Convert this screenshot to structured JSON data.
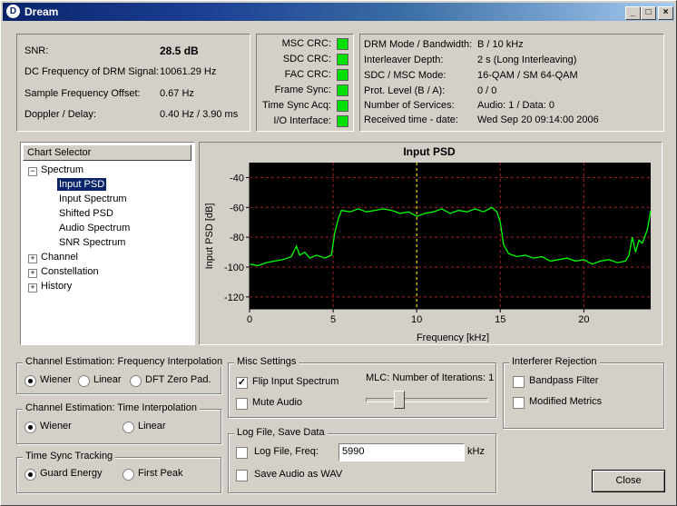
{
  "window": {
    "title": "Dream",
    "min_glyph": "_",
    "max_glyph": "□",
    "close_glyph": "×"
  },
  "status": {
    "snr_label": "SNR:",
    "snr_value": "28.5 dB",
    "dc_freq_label": "DC Frequency of DRM Signal:",
    "dc_freq_value": "10061.29 Hz",
    "sample_offset_label": "Sample Frequency Offset:",
    "sample_offset_value": "0.67 Hz",
    "doppler_label": "Doppler / Delay:",
    "doppler_value": "0.40 Hz / 3.90 ms"
  },
  "crc": {
    "msc": "MSC CRC:",
    "sdc": "SDC CRC:",
    "fac": "FAC CRC:",
    "frame_sync": "Frame Sync:",
    "time_sync": "Time Sync Acq:",
    "io": "I/O Interface:",
    "led_color": "#00e000"
  },
  "drm_info": {
    "mode_label": "DRM Mode / Bandwidth:",
    "mode_value": "B / 10 kHz",
    "interleaver_label": "Interleaver Depth:",
    "interleaver_value": "2 s (Long Interleaving)",
    "sdc_msc_label": "SDC / MSC Mode:",
    "sdc_msc_value": "16-QAM / SM 64-QAM",
    "prot_label": "Prot. Level (B / A):",
    "prot_value": "0 / 0",
    "services_label": "Number of Services:",
    "services_value": "Audio: 1 / Data: 0",
    "received_label": "Received time - date:",
    "received_value": "Wed Sep 20 09:14:00 2006"
  },
  "chart_selector": {
    "header": "Chart Selector",
    "spectrum": "Spectrum",
    "children": [
      "Input PSD",
      "Input Spectrum",
      "Shifted PSD",
      "Audio Spectrum",
      "SNR Spectrum"
    ],
    "channel": "Channel",
    "constellation": "Constellation",
    "history": "History",
    "expand_glyph": "+",
    "collapse_glyph": "−"
  },
  "chart_data": {
    "type": "line",
    "title": "Input PSD",
    "xlabel": "Frequency [kHz]",
    "ylabel": "Input PSD [dB]",
    "xlim": [
      0,
      24
    ],
    "ylim": [
      -128,
      -30
    ],
    "xticks": [
      "0",
      "5",
      "10",
      "15",
      "20"
    ],
    "yticks": [
      "-40",
      "-60",
      "-80",
      "-100",
      "-120"
    ],
    "marker_x": 10,
    "colors": {
      "background": "#000000",
      "grid": "#a02020",
      "line": "#00ff00",
      "marker": "#ffff00"
    },
    "x": [
      0,
      0.5,
      1,
      1.5,
      2,
      2.5,
      2.8,
      3,
      3.3,
      3.6,
      4,
      4.5,
      4.9,
      5.1,
      5.3,
      5.5,
      6,
      6.5,
      7,
      7.5,
      8,
      8.5,
      9,
      9.5,
      10,
      10.5,
      11,
      11.5,
      12,
      12.5,
      13,
      13.5,
      14,
      14.5,
      14.8,
      15,
      15.2,
      15.5,
      16,
      16.5,
      17,
      17.5,
      18,
      18.5,
      19,
      19.5,
      20,
      20.5,
      21,
      21.5,
      22,
      22.5,
      22.7,
      22.9,
      23.1,
      23.3,
      23.5,
      23.8,
      24
    ],
    "y": [
      -98,
      -99,
      -97,
      -96,
      -95,
      -93,
      -86,
      -92,
      -90,
      -94,
      -92,
      -94,
      -92,
      -77,
      -68,
      -62,
      -63,
      -61,
      -63,
      -62,
      -61,
      -62,
      -64,
      -63,
      -66,
      -64,
      -63,
      -61,
      -64,
      -62,
      -63,
      -61,
      -63,
      -60,
      -63,
      -70,
      -85,
      -91,
      -93,
      -92,
      -94,
      -93,
      -96,
      -95,
      -94,
      -96,
      -95,
      -98,
      -96,
      -95,
      -97,
      -96,
      -92,
      -80,
      -90,
      -82,
      -84,
      -75,
      -62
    ]
  },
  "freq_interp": {
    "title": "Channel Estimation: Frequency Interpolation",
    "options": [
      "Wiener",
      "Linear",
      "DFT Zero Pad."
    ],
    "selected": "Wiener"
  },
  "time_interp": {
    "title": "Channel Estimation: Time Interpolation",
    "options": [
      "Wiener",
      "Linear"
    ],
    "selected": "Wiener"
  },
  "time_sync": {
    "title": "Time Sync Tracking",
    "options": [
      "Guard Energy",
      "First Peak"
    ],
    "selected": "Guard Energy"
  },
  "misc": {
    "title": "Misc Settings",
    "flip_label": "Flip Input Spectrum",
    "flip_checked": true,
    "mute_label": "Mute Audio",
    "mute_checked": false,
    "mlc_label": "MLC: Number of Iterations: 1",
    "mlc_value": 1,
    "mlc_min": 0,
    "mlc_max": 4,
    "check_glyph": "✓"
  },
  "interferer": {
    "title": "Interferer Rejection",
    "bandpass_label": "Bandpass Filter",
    "modified_label": "Modified Metrics"
  },
  "logfile": {
    "title": "Log File, Save Data",
    "log_label": "Log File, Freq:",
    "freq_value": "5990",
    "unit": "kHz",
    "save_label": "Save Audio as WAV"
  },
  "close_button": "Close"
}
